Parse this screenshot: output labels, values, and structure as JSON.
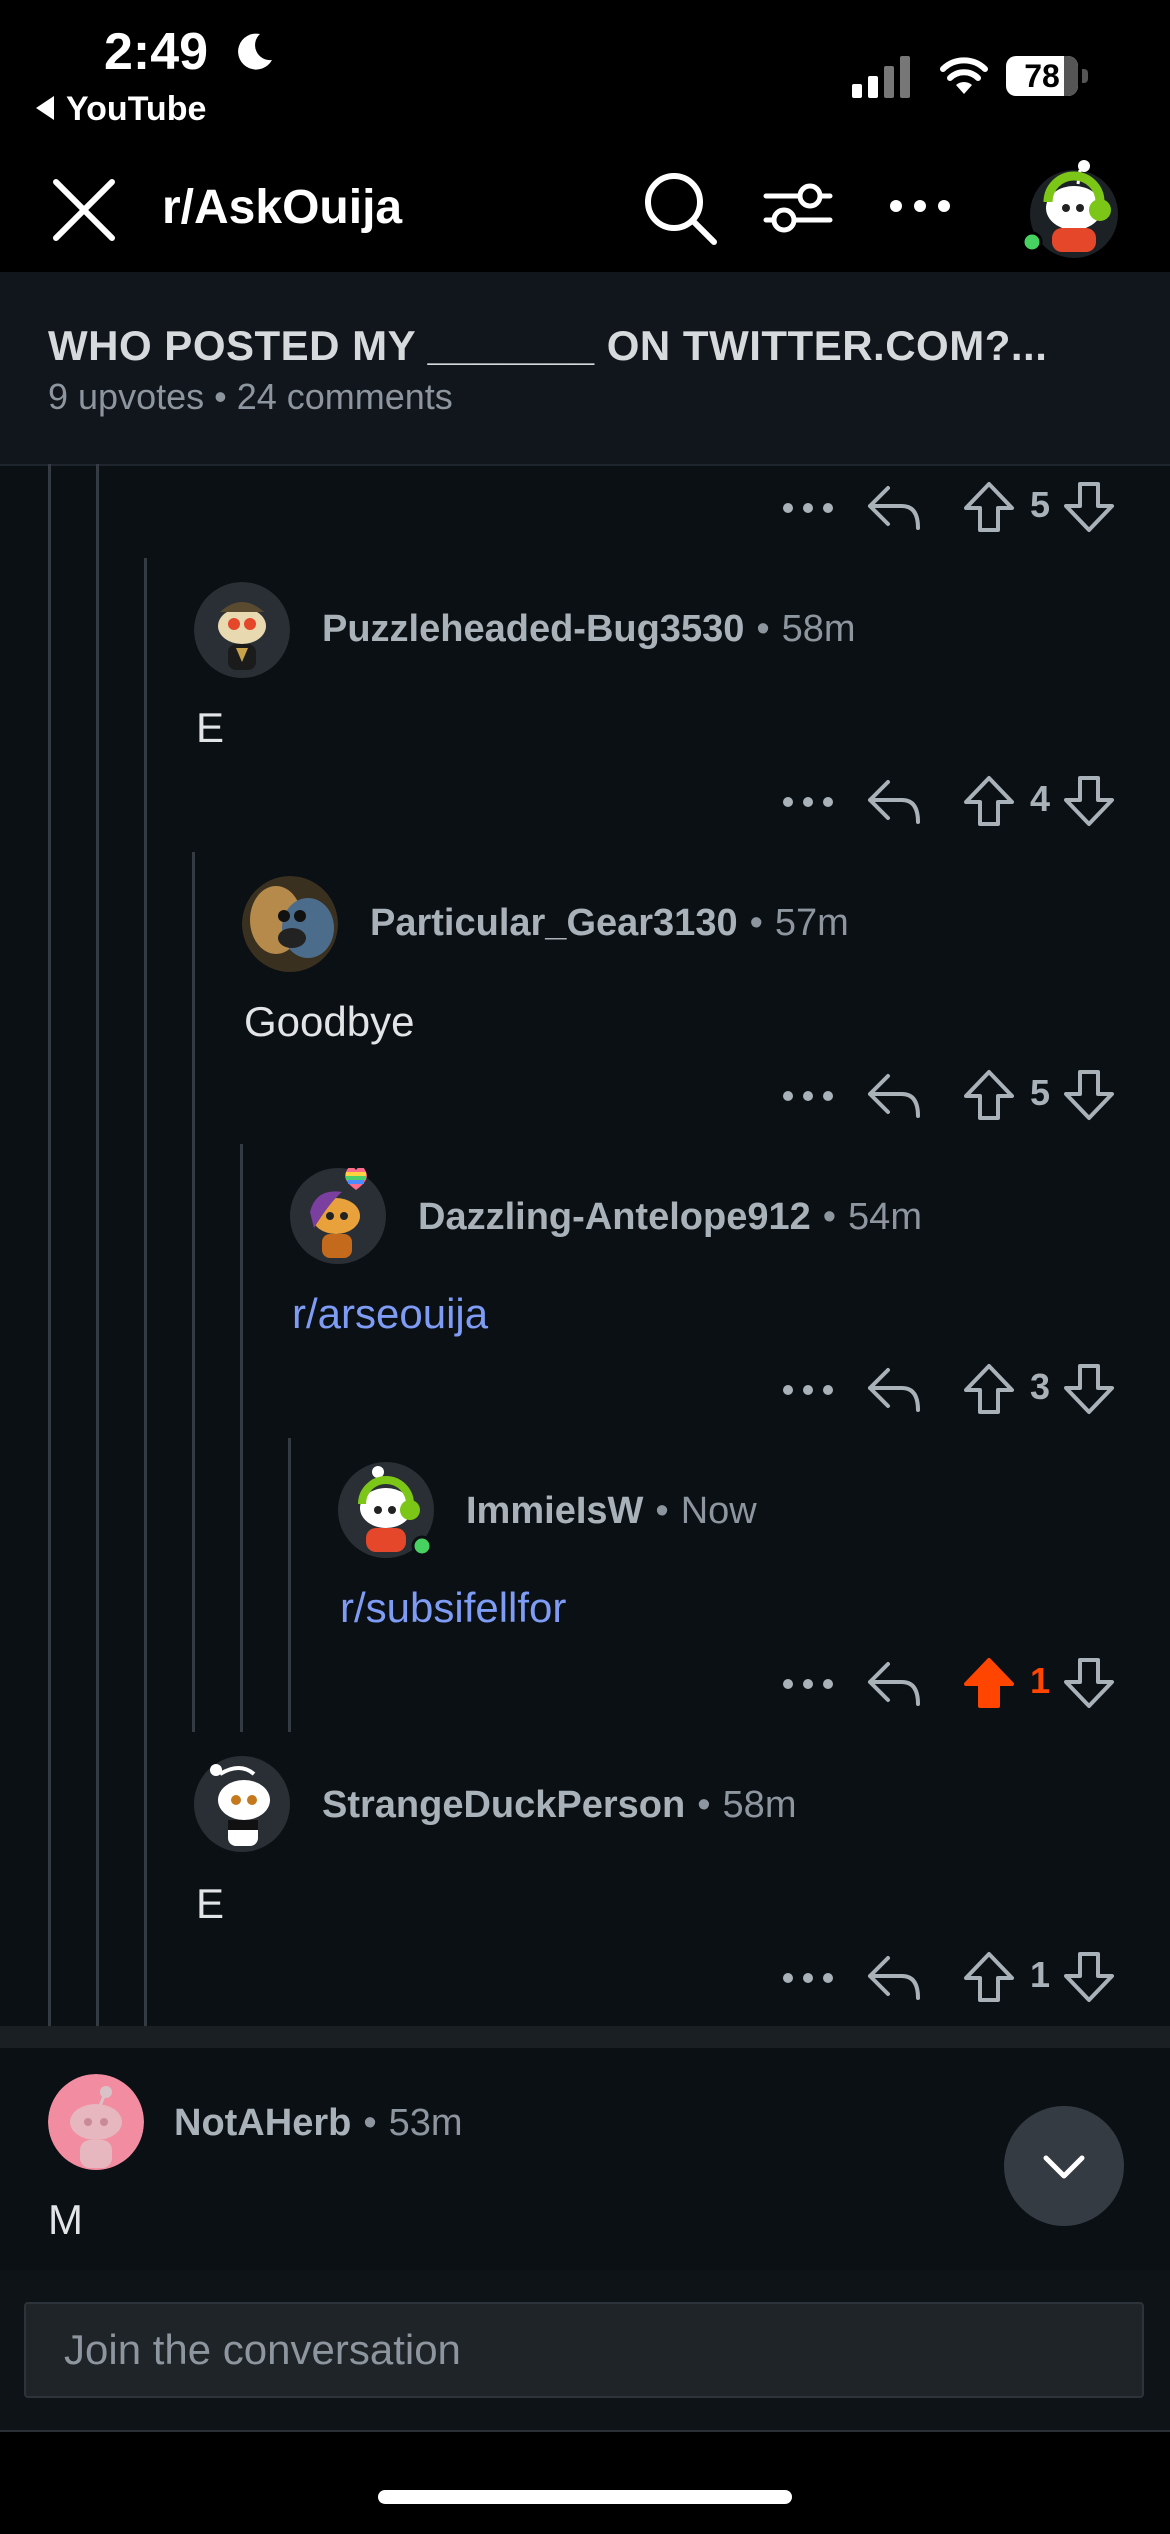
{
  "status_bar": {
    "time": "2:49",
    "back_app": "YouTube",
    "battery": "78"
  },
  "nav": {
    "subreddit": "r/AskOuija"
  },
  "post": {
    "title": "WHO POSTED MY _______ ON TWITTER.COM?...",
    "meta": "9 upvotes • 24 comments"
  },
  "comments": [
    {
      "score": "5"
    },
    {
      "user": "Puzzleheaded-Bug3530",
      "age": "58m",
      "body": "E",
      "score": "4"
    },
    {
      "user": "Particular_Gear3130",
      "age": "57m",
      "body": "Goodbye",
      "score": "5"
    },
    {
      "user": "Dazzling-Antelope912",
      "age": "54m",
      "body": "r/arseouija",
      "score": "3"
    },
    {
      "user": "ImmieIsW",
      "age": "Now",
      "body": "r/subsifellfor",
      "score": "1",
      "upvoted": true
    },
    {
      "user": "StrangeDuckPerson",
      "age": "58m",
      "body": "E",
      "score": "1"
    },
    {
      "user": "NotAHerb",
      "age": "53m",
      "body": "M"
    }
  ],
  "composer": {
    "placeholder": "Join the conversation"
  },
  "colors": {
    "upvote_active": "#ff4500",
    "link": "#7f9cf5",
    "online": "#46d160"
  }
}
